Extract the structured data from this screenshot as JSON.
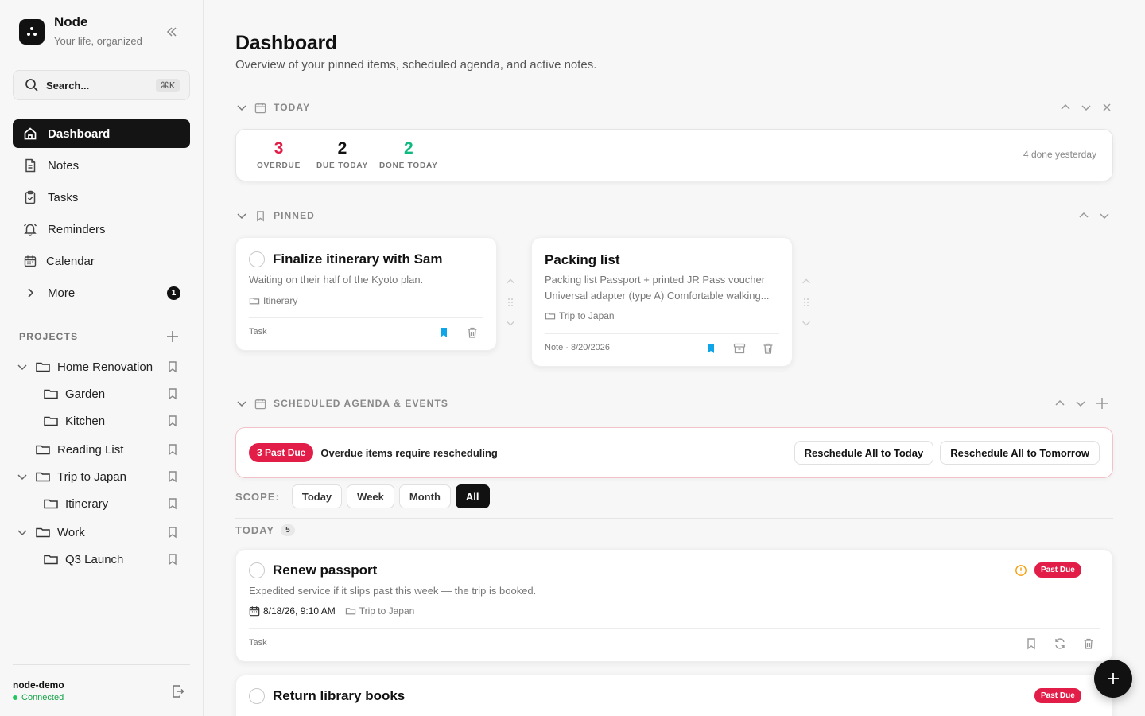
{
  "brand": {
    "name": "Node",
    "tagline": "Your life, organized"
  },
  "search": {
    "label": "Search...",
    "shortcut": "⌘K"
  },
  "nav": {
    "dashboard": "Dashboard",
    "notes": "Notes",
    "tasks": "Tasks",
    "reminders": "Reminders",
    "calendar": "Calendar",
    "more": "More",
    "more_badge": "1"
  },
  "projects": {
    "title": "PROJECTS",
    "items": [
      "Home Renovation",
      "Garden",
      "Kitchen",
      "Reading List",
      "Trip to Japan",
      "Itinerary",
      "Work",
      "Q3 Launch"
    ]
  },
  "footer": {
    "user": "node-demo",
    "status": "Connected"
  },
  "page": {
    "title": "Dashboard",
    "subtitle": "Overview of your pinned items, scheduled agenda, and active notes."
  },
  "today": {
    "title": "TODAY",
    "overdue": "3",
    "overdue_label": "OVERDUE",
    "due": "2",
    "due_label": "DUE TODAY",
    "done": "2",
    "done_label": "DONE TODAY",
    "yesterday": "4 done yesterday"
  },
  "pinned": {
    "title": "PINNED",
    "card1": {
      "title": "Finalize itinerary with Sam",
      "desc": "Waiting on their half of the Kyoto plan.",
      "folder": "Itinerary",
      "type": "Task"
    },
    "card2": {
      "title": "Packing list",
      "desc_line1": "Packing list Passport + printed JR Pass voucher",
      "desc_line2": "Universal adapter (type A) Comfortable walking...",
      "folder": "Trip to Japan",
      "type": "Note · 8/20/2026"
    }
  },
  "agenda": {
    "title": "SCHEDULED AGENDA & EVENTS",
    "past_due_pill": "3 Past Due",
    "message": "Overdue items require rescheduling",
    "btn_today": "Reschedule All to Today",
    "btn_tomorrow": "Reschedule All to Tomorrow",
    "scope_label": "SCOPE:",
    "scopes": [
      "Today",
      "Week",
      "Month",
      "All"
    ],
    "active_scope": "All",
    "group_title": "TODAY",
    "group_count": "5",
    "item1": {
      "title": "Renew passport",
      "desc": "Expedited service if it slips past this week — the trip is booked.",
      "date": "8/18/26, 9:10 AM",
      "folder": "Trip to Japan",
      "type": "Task",
      "badge": "Past Due"
    },
    "item2": {
      "title": "Return library books",
      "badge": "Past Due"
    }
  },
  "colors": {
    "accent": "#111111",
    "overdue": "#e11d48",
    "done": "#10b981",
    "pin": "#0ea5e9",
    "warning": "#f59e0b"
  },
  "icons": [
    "app-logo",
    "collapse-icon",
    "search-icon",
    "home-icon",
    "notes-icon",
    "tasks-icon",
    "bell-icon",
    "calendar-icon",
    "chevron-right-icon",
    "plus-icon",
    "folder-icon",
    "bookmark-icon",
    "logout-icon",
    "trash-icon",
    "archive-icon",
    "refresh-icon",
    "alert-circle-icon"
  ]
}
